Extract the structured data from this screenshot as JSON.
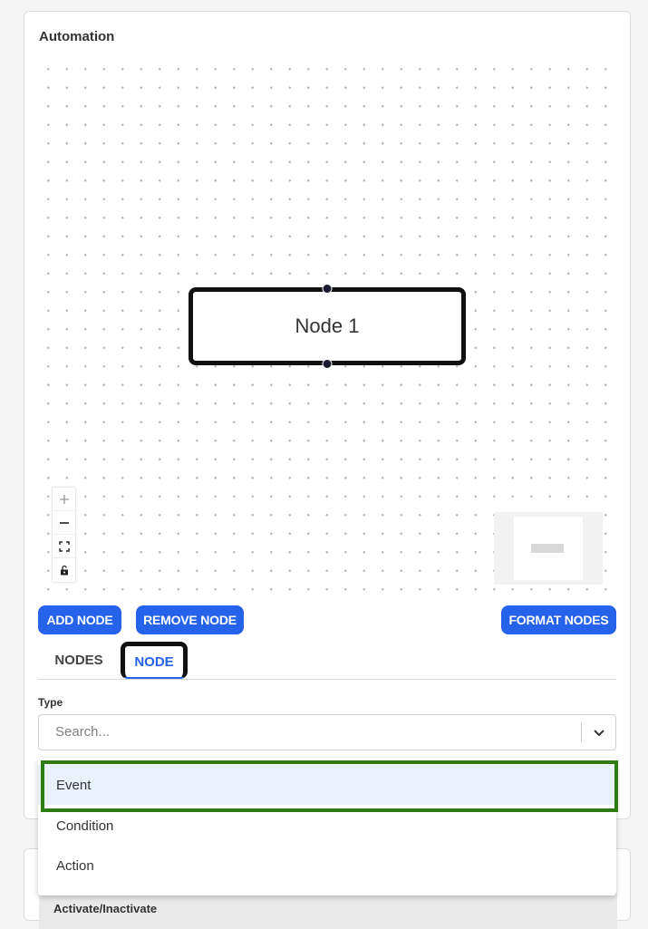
{
  "card": {
    "title": "Automation"
  },
  "canvas": {
    "node": {
      "label": "Node 1"
    },
    "controls": [
      {
        "name": "zoom-in",
        "icon": "plus-icon"
      },
      {
        "name": "zoom-out",
        "icon": "minus-icon"
      },
      {
        "name": "fit-view",
        "icon": "fit-view-icon"
      },
      {
        "name": "toggle-interactivity",
        "icon": "lock-open-icon"
      }
    ]
  },
  "toolbar": {
    "add_label": "ADD NODE",
    "remove_label": "REMOVE NODE",
    "format_label": "FORMAT NODES"
  },
  "tabs": [
    {
      "label": "NODES",
      "active": false
    },
    {
      "label": "NODE",
      "active": true
    }
  ],
  "type_field": {
    "label": "Type",
    "placeholder": "Search...",
    "options": [
      "Event",
      "Condition",
      "Action"
    ],
    "highlighted": "Event"
  },
  "section2": {
    "label": "Activate/Inactivate"
  },
  "colors": {
    "accent": "#2563eb",
    "highlight_border": "#2e7d12",
    "option_hover": "#e8f2fc"
  }
}
